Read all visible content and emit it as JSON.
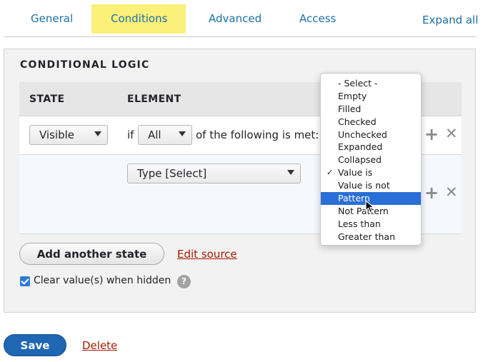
{
  "tabs": [
    {
      "label": "General"
    },
    {
      "label": "Conditions",
      "active": true
    },
    {
      "label": "Advanced"
    },
    {
      "label": "Access"
    }
  ],
  "expand_all": "Expand all",
  "fieldset": {
    "legend": "CONDITIONAL LOGIC",
    "headers": {
      "state": "STATE",
      "element": "ELEMENT"
    },
    "row1": {
      "state_select": "Visible",
      "if_text": "if",
      "logic_select": "All",
      "following_text": "of the following is met:"
    },
    "row2": {
      "element_select": "Type [Select]"
    },
    "add_state_label": "Add another state",
    "edit_source_label": "Edit source",
    "clear_checkbox_label": "Clear value(s) when hidden",
    "help_glyph": "?",
    "clear_checked": true
  },
  "actions": {
    "save": "Save",
    "delete": "Delete"
  },
  "dropdown": {
    "items": [
      "- Select -",
      "Empty",
      "Filled",
      "Checked",
      "Unchecked",
      "Expanded",
      "Collapsed",
      "Value is",
      "Value is not",
      "Pattern",
      "Not Pattern",
      "Less than",
      "Greater than"
    ],
    "checked_item": "Value is",
    "highlighted_item": "Pattern",
    "check_glyph": "✓"
  },
  "colors": {
    "link_blue": "#1d6fa5",
    "active_tab_bg": "#fbf07a",
    "save_blue": "#1f66b3",
    "danger_red": "#a51b00",
    "menu_highlight": "#2a6fd6"
  }
}
